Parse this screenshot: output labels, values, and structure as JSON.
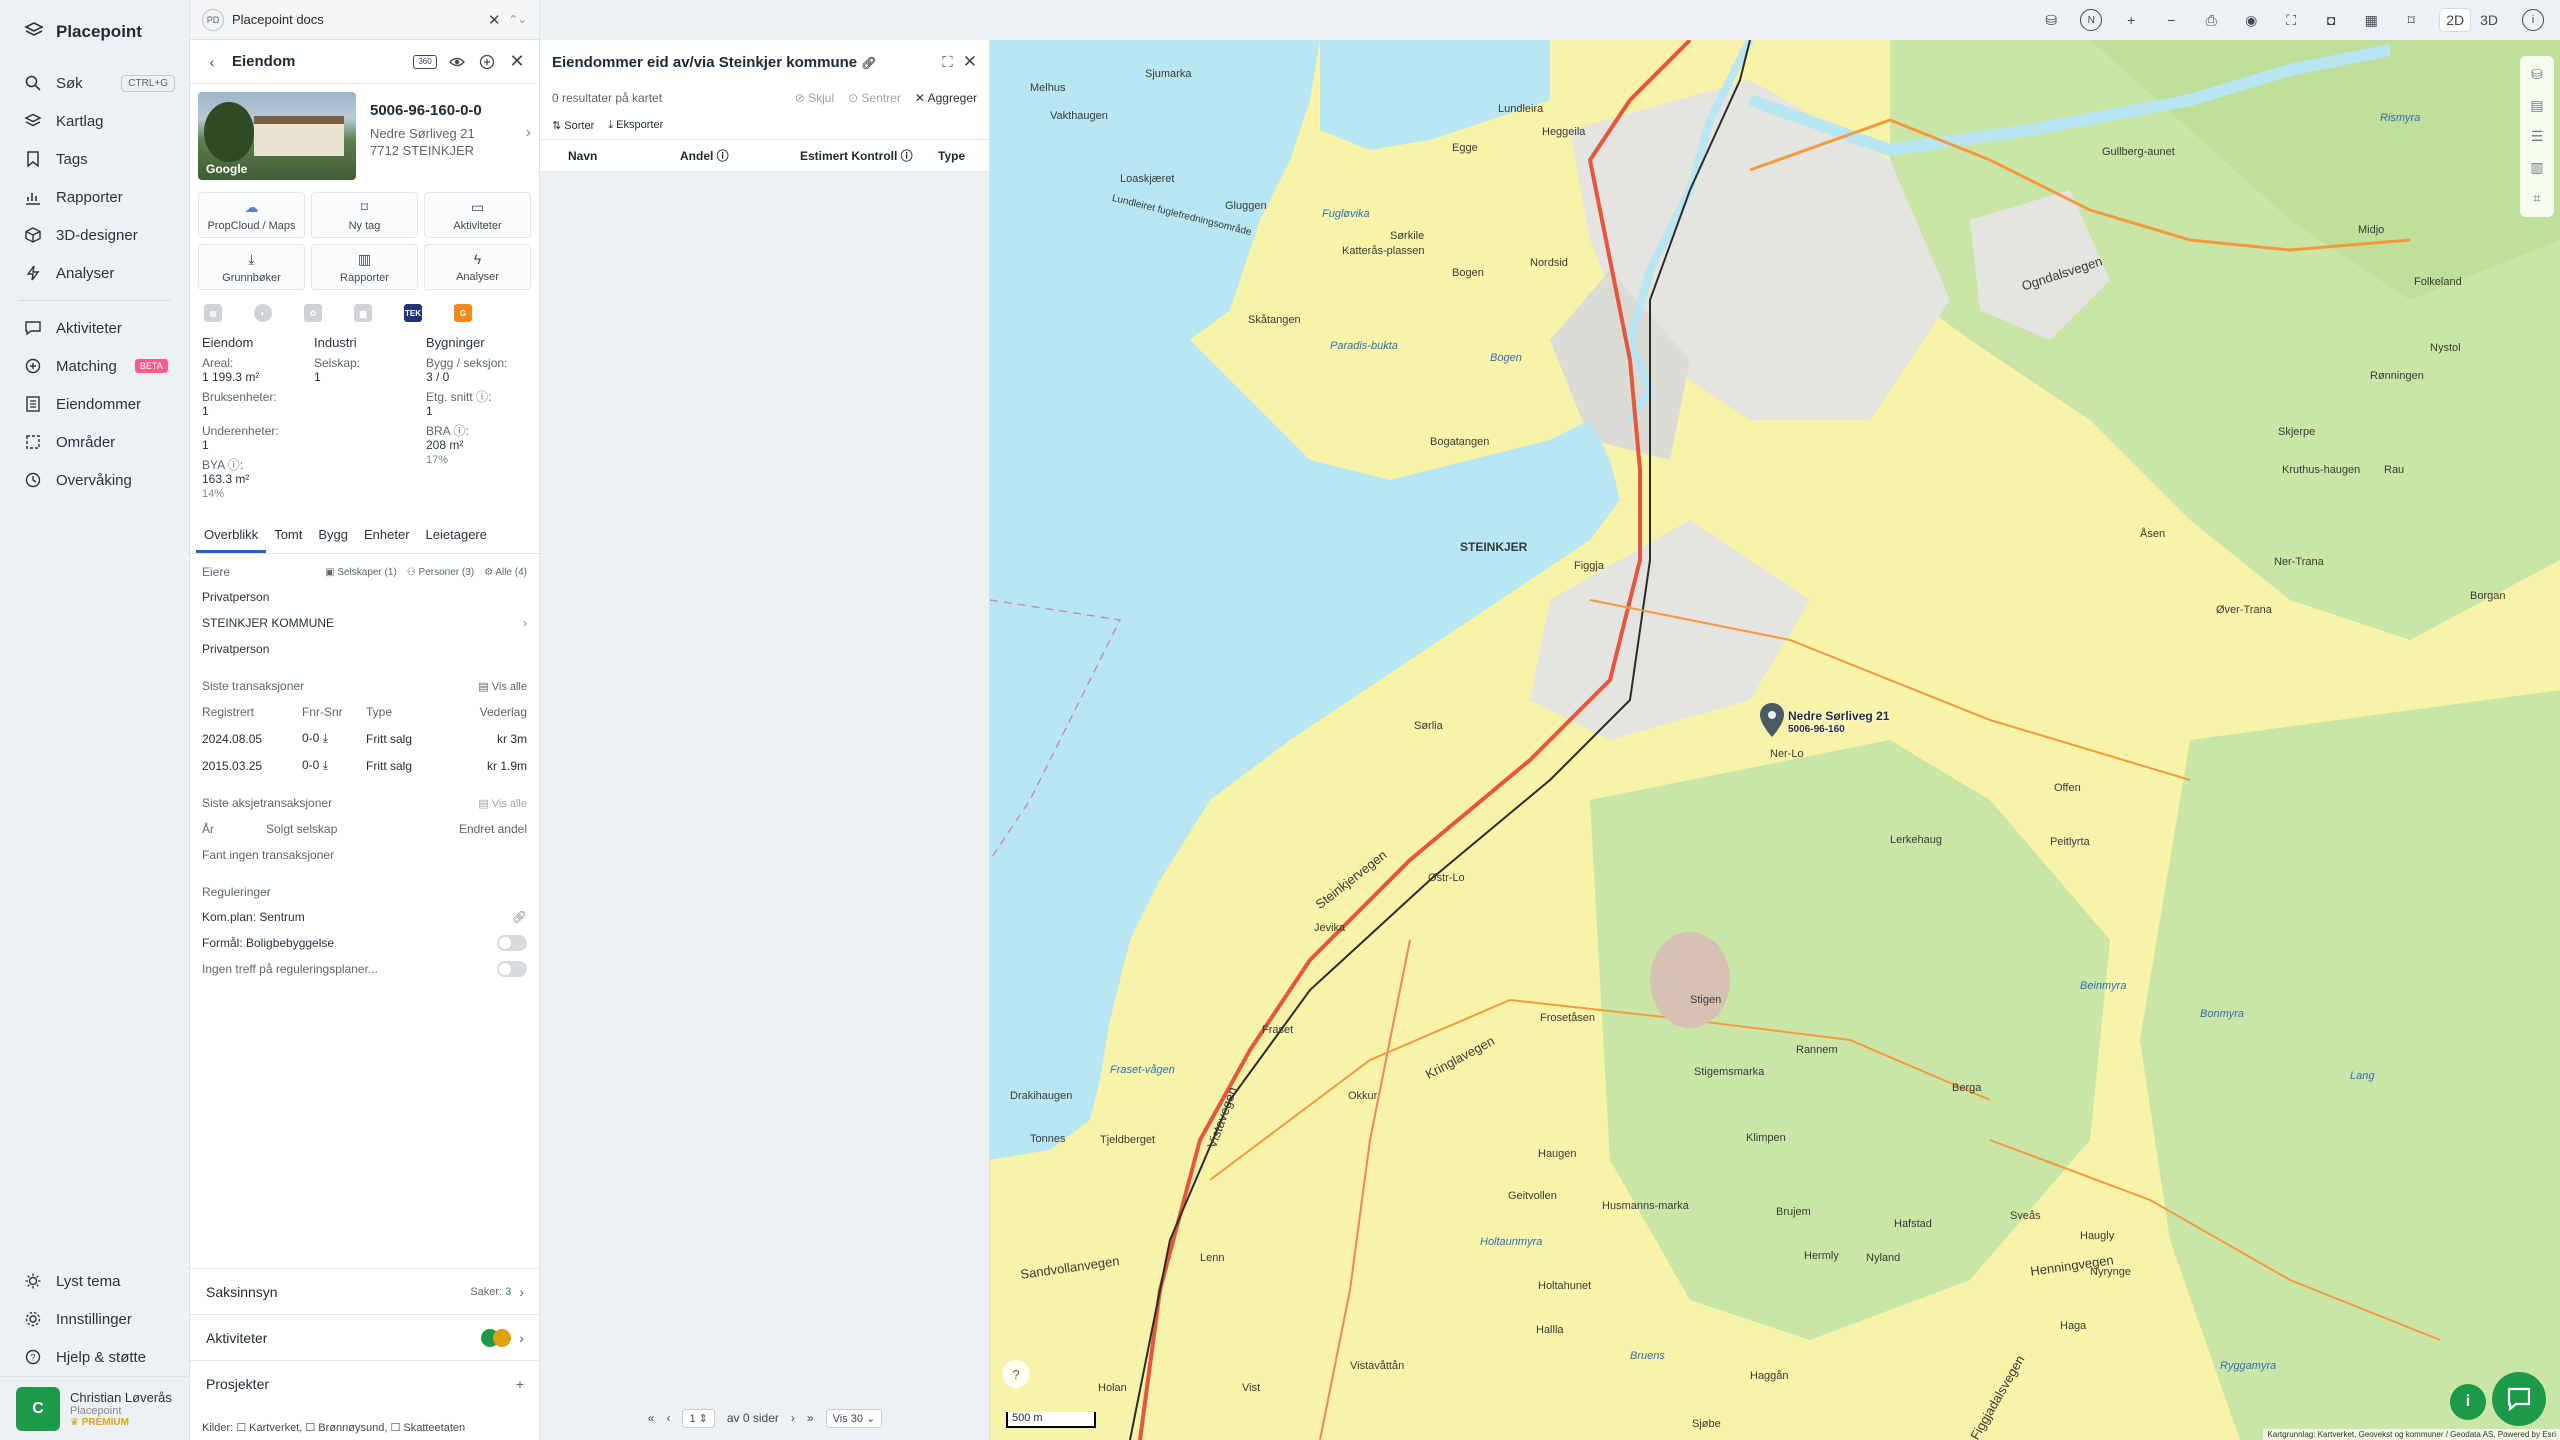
{
  "nav": {
    "brand": "Placepoint",
    "items": [
      {
        "label": "Søk",
        "icon": "search-icon",
        "shortcut": "CTRL+G"
      },
      {
        "label": "Kartlag",
        "icon": "layers-icon"
      },
      {
        "label": "Tags",
        "icon": "bookmark-icon"
      },
      {
        "label": "Rapporter",
        "icon": "chart-icon"
      },
      {
        "label": "3D-designer",
        "icon": "cube-icon"
      },
      {
        "label": "Analyser",
        "icon": "bolt-icon"
      }
    ],
    "items2": [
      {
        "label": "Aktiviteter",
        "icon": "chat-icon"
      },
      {
        "label": "Matching",
        "icon": "matching-icon",
        "badge": "BETA"
      },
      {
        "label": "Eiendommer",
        "icon": "building-icon"
      },
      {
        "label": "Områder",
        "icon": "area-icon"
      },
      {
        "label": "Overvåking",
        "icon": "clock-icon"
      }
    ],
    "bottom": [
      {
        "label": "Lyst tema",
        "icon": "sun-icon"
      },
      {
        "label": "Innstillinger",
        "icon": "gear-icon"
      },
      {
        "label": "Hjelp & støtte",
        "icon": "help-icon"
      }
    ],
    "user": {
      "initial": "C",
      "name": "Christian Løverås",
      "org": "Placepoint",
      "plan": "PREMIUM"
    }
  },
  "doc_tab": {
    "badge": "PD",
    "title": "Placepoint docs"
  },
  "property": {
    "header": "Eiendom",
    "badge": "360",
    "id": "5006-96-160-0-0",
    "address": "Nedre Sørliveg 21",
    "postal": "7712 STEINKJER",
    "photo_label": "Google",
    "actions": [
      {
        "label": "PropCloud / Maps",
        "icon": "cloud-icon"
      },
      {
        "label": "Ny tag",
        "icon": "bookmark-icon"
      },
      {
        "label": "Aktiviteter",
        "icon": "chat-icon"
      },
      {
        "label": "Grunnbøker",
        "icon": "download-icon"
      },
      {
        "label": "Rapporter",
        "icon": "chart-icon"
      },
      {
        "label": "Analyser",
        "icon": "bolt-icon"
      }
    ],
    "source_logos": [
      "grid-logo",
      "globe-logo",
      "plant-logo",
      "bars-logo",
      "tek-logo",
      "g-logo"
    ],
    "stats": {
      "col1_head": "Eiendom",
      "col2_head": "Industri",
      "col3_head": "Bygninger",
      "areal_k": "Areal:",
      "areal_v": "1 199.3 m²",
      "selskap_k": "Selskap:",
      "selskap_v": "1",
      "bygg_k": "Bygg / seksjon:",
      "bygg_v": "3 / 0",
      "bruks_k": "Bruksenheter:",
      "bruks_v": "1",
      "etg_k": "Etg. snitt ⓘ:",
      "etg_v": "1",
      "under_k": "Underenheter:",
      "under_v": "1",
      "bra_k": "BRA ⓘ:",
      "bra_v": "208 m²",
      "bra_p": "17%",
      "bya_k": "BYA ⓘ:",
      "bya_v": "163.3 m²",
      "bya_p": "14%"
    },
    "tabs": [
      "Overblikk",
      "Tomt",
      "Bygg",
      "Enheter",
      "Leietagere"
    ],
    "owners": {
      "title": "Eiere",
      "filters": [
        "Selskaper (1)",
        "Personer (3)",
        "Alle (4)"
      ],
      "list": [
        "Privatperson",
        "STEINKJER KOMMUNE",
        "Privatperson"
      ]
    },
    "transactions": {
      "title": "Siste transaksjoner",
      "view_all": "Vis alle",
      "headers": [
        "Registrert",
        "Fnr-Snr",
        "Type",
        "Vederlag"
      ],
      "rows": [
        {
          "date": "2024.08.05",
          "fnr": "0-0",
          "type": "Fritt salg",
          "amount": "kr 3m"
        },
        {
          "date": "2015.03.25",
          "fnr": "0-0",
          "type": "Fritt salg",
          "amount": "kr 1.9m"
        }
      ]
    },
    "share_transactions": {
      "title": "Siste aksjetransaksjoner",
      "view_all": "Vis alle",
      "headers": [
        "År",
        "Solgt selskap",
        "Endret andel"
      ],
      "empty": "Fant ingen transaksjoner"
    },
    "regulations": {
      "title": "Reguleringer",
      "plan": "Kom.plan: Sentrum",
      "purpose": "Formål: Boligbebyggelse",
      "none": "Ingen treff på reguleringsplaner..."
    },
    "accordion": {
      "saksinnsyn": "Saksinnsyn",
      "saker": "Saker:",
      "saker_count": "3",
      "aktiviteter": "Aktiviteter",
      "prosjekter": "Prosjekter"
    },
    "sources": "Kilder: ☐ Kartverket, ☐ Brønnøysund, ☐ Skatteetaten"
  },
  "owners_panel": {
    "title": "Eiendommer eid av/via Steinkjer kommune",
    "results": "0 resultater på kartet",
    "hide": "Skjul",
    "center": "Sentrer",
    "aggregate": "Aggreger",
    "sort": "Sorter",
    "export": "Eksporter",
    "columns": [
      "Navn",
      "Andel ⓘ",
      "Estimert Kontroll ⓘ",
      "Type"
    ],
    "pager": {
      "page": "1",
      "of": "av 0 sider",
      "per_page": "Vis 30"
    }
  },
  "map": {
    "view_2d": "2D",
    "view_3d": "3D",
    "scale": "500 m",
    "attribution": "Kartgrunnlag: Kartverket, Geovekst og kommuner / Geodata AS, Powered by Esri",
    "marker_label": "Nedre Sørliveg 21",
    "marker_sub": "5006-96-160",
    "colors": {
      "water": "#b8e6f2",
      "land": "#f7f3a8",
      "forest": "#c9e6a6",
      "urban": "#e4e4e0",
      "road": "#e8553d"
    },
    "place_labels": [
      {
        "t": "STEINKJER",
        "cls": "city"
      },
      {
        "t": "Lundleira"
      },
      {
        "t": "Melhus"
      },
      {
        "t": "Vakthaugen"
      },
      {
        "t": "Sjumarka"
      },
      {
        "t": "Loaskjæret"
      },
      {
        "t": "Gluggen"
      },
      {
        "t": "Egge"
      },
      {
        "t": "Heggeila"
      },
      {
        "t": "Sørkile"
      },
      {
        "t": "Katterås-plassen"
      },
      {
        "t": "Bogen"
      },
      {
        "t": "Nordsid"
      },
      {
        "t": "Skåtangen"
      },
      {
        "t": "Bogatangen"
      },
      {
        "t": "Figgja"
      },
      {
        "t": "Sørlia"
      },
      {
        "t": "Ner-Lo"
      },
      {
        "t": "Jevika"
      },
      {
        "t": "Fraset"
      },
      {
        "t": "Frosetåsen"
      },
      {
        "t": "Stigemsmarka"
      },
      {
        "t": "Drakihaugen"
      },
      {
        "t": "Tonnes"
      },
      {
        "t": "Tjeldberget"
      },
      {
        "t": "Okkur"
      },
      {
        "t": "Haugen"
      },
      {
        "t": "Geitvollen"
      },
      {
        "t": "Klimpen"
      },
      {
        "t": "Brujem"
      },
      {
        "t": "Hermly"
      },
      {
        "t": "Nyland"
      },
      {
        "t": "Husmanns-marka"
      },
      {
        "t": "Holtahunet"
      },
      {
        "t": "Hallla"
      },
      {
        "t": "Lenn"
      },
      {
        "t": "Vist"
      },
      {
        "t": "Holan"
      },
      {
        "t": "Vistavåttån"
      },
      {
        "t": "Sjøbe"
      },
      {
        "t": "Haggån"
      },
      {
        "t": "Hafstad"
      },
      {
        "t": "Sveås"
      },
      {
        "t": "Haugly"
      },
      {
        "t": "Nyrynge"
      },
      {
        "t": "Haga"
      },
      {
        "t": "Rannem"
      },
      {
        "t": "Berga"
      },
      {
        "t": "Peitlyrta"
      },
      {
        "t": "Lerkehaug"
      },
      {
        "t": "Offen"
      },
      {
        "t": "Åsen"
      },
      {
        "t": "Stigen"
      },
      {
        "t": "Østr-Lo"
      },
      {
        "t": "Ogndalsvegen"
      },
      {
        "t": "Steinkjervegen"
      },
      {
        "t": "Kringlavegen"
      },
      {
        "t": "Vistavegen"
      },
      {
        "t": "Sandvollanvegen"
      },
      {
        "t": "Henningvegen"
      },
      {
        "t": "Figgjadalsvegen"
      },
      {
        "t": "Rønningen"
      },
      {
        "t": "Nystol"
      },
      {
        "t": "Kruthus-haugen"
      },
      {
        "t": "Rau"
      },
      {
        "t": "Skjerpe"
      },
      {
        "t": "Ner-Trana"
      },
      {
        "t": "Øver-Trana"
      },
      {
        "t": "Borgan"
      },
      {
        "t": "Gullberg-aunet"
      },
      {
        "t": "Folkeland"
      },
      {
        "t": "Midjo"
      }
    ],
    "water_labels": [
      {
        "t": "Fugløvika"
      },
      {
        "t": "Paradis-bukta"
      },
      {
        "t": "Bogen"
      },
      {
        "t": "Fraset-vågen"
      },
      {
        "t": "Holtaunmyra"
      },
      {
        "t": "Bruens"
      },
      {
        "t": "Bonmyra"
      },
      {
        "t": "Beinmyra"
      },
      {
        "t": "Ryggamyra"
      },
      {
        "t": "Lang"
      },
      {
        "t": "Rismyra"
      },
      {
        "t": "Lundleiret fuglefredningsområde"
      }
    ]
  }
}
